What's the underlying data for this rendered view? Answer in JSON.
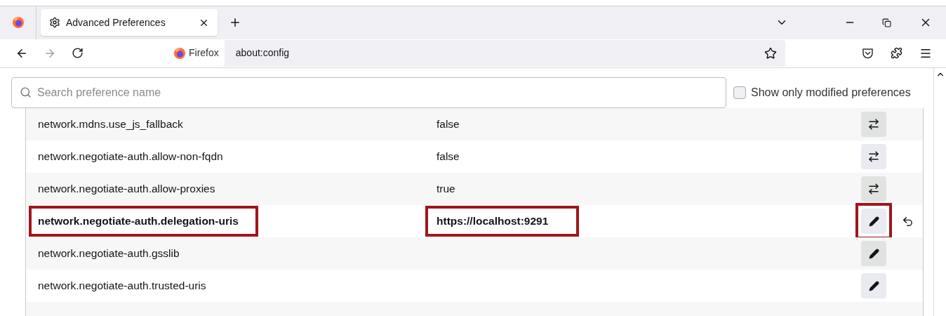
{
  "tab": {
    "title": "Advanced Preferences",
    "selected": true
  },
  "address": {
    "identity": "Firefox",
    "url": "about:config"
  },
  "search": {
    "placeholder": "Search preference name"
  },
  "modified_only": {
    "label": "Show only modified preferences",
    "checked": false
  },
  "rows": [
    {
      "name": "network.mdns.use_js_fallback",
      "value": "false",
      "kind": "boolean",
      "modified": false,
      "highlighted": false
    },
    {
      "name": "network.negotiate-auth.allow-non-fqdn",
      "value": "false",
      "kind": "boolean",
      "modified": false,
      "highlighted": false
    },
    {
      "name": "network.negotiate-auth.allow-proxies",
      "value": "true",
      "kind": "boolean",
      "modified": false,
      "highlighted": false
    },
    {
      "name": "network.negotiate-auth.delegation-uris",
      "value": "https://localhost:9291",
      "kind": "string",
      "modified": true,
      "highlighted": true
    },
    {
      "name": "network.negotiate-auth.gsslib",
      "value": "",
      "kind": "string",
      "modified": false,
      "highlighted": false
    },
    {
      "name": "network.negotiate-auth.trusted-uris",
      "value": "",
      "kind": "string",
      "modified": false,
      "highlighted": false
    }
  ]
}
